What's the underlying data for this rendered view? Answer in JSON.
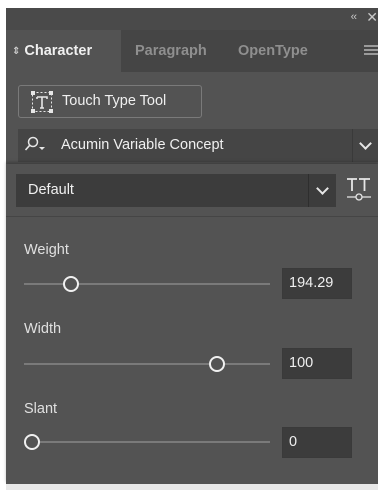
{
  "window": {
    "collapse_icon": "double-chevron-left-icon",
    "collapse_glyph": "‹‹",
    "close_icon": "close-icon",
    "close_glyph": "✕"
  },
  "tabs": [
    {
      "label": "Character",
      "active": true
    },
    {
      "label": "Paragraph",
      "active": false
    },
    {
      "label": "OpenType",
      "active": false
    }
  ],
  "tab_arrows_glyph": "⇕",
  "touch_type": {
    "label": "Touch Type Tool",
    "icon": "touch-type-icon"
  },
  "font": {
    "family": "Acumin Variable Concept",
    "search_icon": "font-search-icon"
  },
  "style": {
    "value": "Default",
    "icon": "variable-font-icon"
  },
  "axes": [
    {
      "label": "Weight",
      "value": "194.29",
      "fraction": 0.16
    },
    {
      "label": "Width",
      "value": "100",
      "fraction": 0.75
    },
    {
      "label": "Slant",
      "value": "0",
      "fraction": 0.0
    }
  ],
  "colors": {
    "panel_bg": "#535353",
    "tab_bar": "#454545",
    "field_bg": "#3c3c3c",
    "text": "#f0f0f0",
    "muted_text": "#8f8f8f"
  }
}
